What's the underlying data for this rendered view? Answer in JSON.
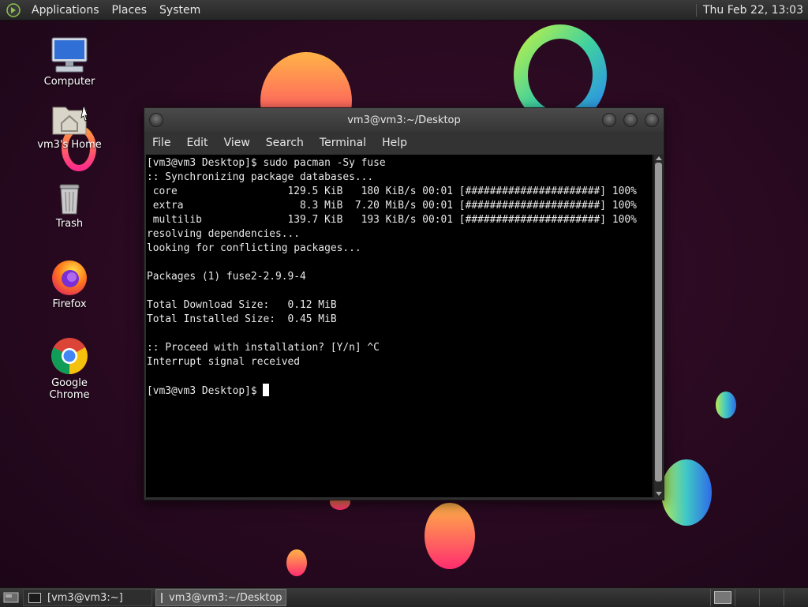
{
  "top_panel": {
    "menus": [
      "Applications",
      "Places",
      "System"
    ],
    "clock": "Thu Feb 22, 13:03"
  },
  "desktop_icons": [
    {
      "label": "Computer",
      "icon": "computer-icon"
    },
    {
      "label": "vm3's Home",
      "icon": "home-folder-icon"
    },
    {
      "label": "Trash",
      "icon": "trash-icon"
    },
    {
      "label": "Firefox",
      "icon": "firefox-icon"
    },
    {
      "label": "Google Chrome",
      "icon": "chrome-icon"
    }
  ],
  "window": {
    "title": "vm3@vm3:~/Desktop",
    "menus": [
      "File",
      "Edit",
      "View",
      "Search",
      "Terminal",
      "Help"
    ]
  },
  "terminal": {
    "lines": [
      "[vm3@vm3 Desktop]$ sudo pacman -Sy fuse",
      ":: Synchronizing package databases...",
      " core                  129.5 KiB   180 KiB/s 00:01 [######################] 100%",
      " extra                   8.3 MiB  7.20 MiB/s 00:01 [######################] 100%",
      " multilib              139.7 KiB   193 KiB/s 00:01 [######################] 100%",
      "resolving dependencies...",
      "looking for conflicting packages...",
      "",
      "Packages (1) fuse2-2.9.9-4",
      "",
      "Total Download Size:   0.12 MiB",
      "Total Installed Size:  0.45 MiB",
      "",
      ":: Proceed with installation? [Y/n] ^C",
      "Interrupt signal received",
      ""
    ],
    "prompt": "[vm3@vm3 Desktop]$ "
  },
  "taskbar": {
    "tasks": [
      {
        "label": "[vm3@vm3:~]",
        "active": false
      },
      {
        "label": "vm3@vm3:~/Desktop",
        "active": true
      }
    ]
  },
  "colors": {
    "background": "#2b0a22",
    "panel": "#333333",
    "terminal_bg": "#000000",
    "terminal_fg": "#e8e8e8"
  }
}
